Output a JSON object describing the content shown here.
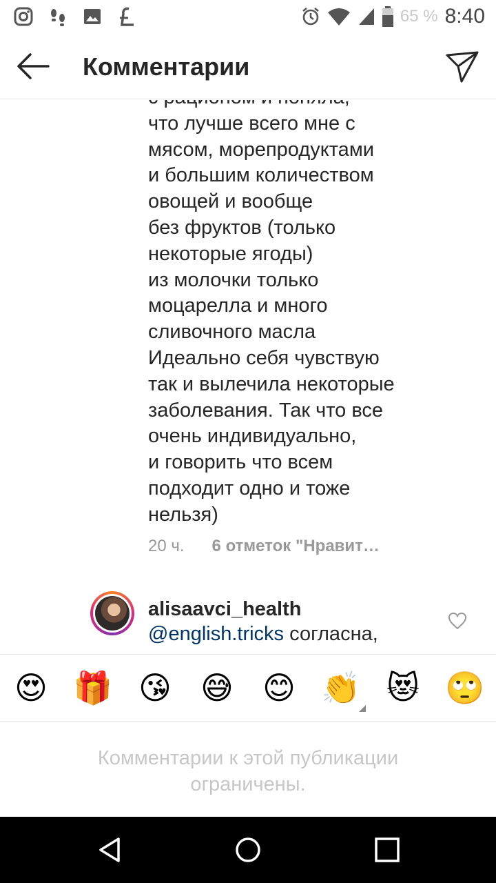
{
  "status_bar": {
    "battery_percent": "65 %",
    "time": "8:40",
    "icons": [
      "instagram-icon",
      "steps-icon",
      "image-icon",
      "lira-icon",
      "alarm-icon",
      "wifi-icon",
      "signal-icon",
      "battery-icon"
    ]
  },
  "header": {
    "title": "Комментарии"
  },
  "comment": {
    "lines": [
      "с рационом и поняла,",
      "что лучше всего мне с",
      "мясом, морепродуктами",
      "и большим количеством",
      "овощей и вообще",
      "без фруктов (только",
      "некоторые ягоды)",
      "из молочки только",
      "моцарелла и много",
      "сливочного масла",
      "Идеально себя чувствую",
      "так и вылечила некоторые",
      "заболевания. Так что все",
      "очень индивидуально,",
      "и говорить что всем",
      "подходит одно и тоже",
      "нельзя)"
    ],
    "time": "20 ч.",
    "likes": "6 отметок \"Нравит…"
  },
  "comment2": {
    "username": "alisaavci_health",
    "mention": "@english.tricks",
    "text": " согласна,"
  },
  "emoji_bar": [
    "😍",
    "🎁",
    "😘",
    "😅",
    "😊",
    "👏",
    "😻",
    "🙄"
  ],
  "restricted": {
    "line1": "Комментарии к этой публикации",
    "line2": "ограничены."
  },
  "colors": {
    "text": "#262626",
    "muted": "#999999",
    "mention": "#003569",
    "restricted": "#c7c7c7"
  }
}
